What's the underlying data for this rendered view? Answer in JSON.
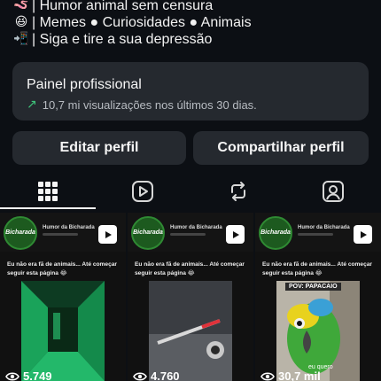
{
  "bio": {
    "lines": [
      {
        "icon": "🪱",
        "text": "| Humor animal sem censura"
      },
      {
        "icon": "😆",
        "text": "| Memes ● Curiosidades ● Animais"
      },
      {
        "icon": "📲",
        "text": "| Siga e tire a sua depressão"
      }
    ]
  },
  "professional_panel": {
    "title": "Painel profissional",
    "subtitle": "10,7 mi visualizações nos últimos 30 dias."
  },
  "buttons": {
    "edit": "Editar perfil",
    "share": "Compartilhar perfil"
  },
  "tabs": [
    {
      "icon": "grid-icon",
      "active": true
    },
    {
      "icon": "reels-icon",
      "active": false
    },
    {
      "icon": "reposts-icon",
      "active": false
    },
    {
      "icon": "tagged-icon",
      "active": false
    }
  ],
  "posts": [
    {
      "account": "Humor da Bicharada",
      "avatar_text": "Bicharada",
      "caption": "Eu não era fã de animais... Até começar seguir esta página 😂",
      "views": "5.749",
      "overlay": ""
    },
    {
      "account": "Humor da Bicharada",
      "avatar_text": "Bicharada",
      "caption": "Eu não era fã de animais... Até começar seguir esta página 😂",
      "views": "4.760",
      "overlay": ""
    },
    {
      "account": "Humor da Bicharada",
      "avatar_text": "Bicharada",
      "caption": "Eu não era fã de animais... Até começar seguir esta página 😂",
      "views": "30,7 mil",
      "overlay": "POV: PAPACAIO",
      "bottom_text": "eu quero"
    }
  ],
  "colors": {
    "background": "#0c0f14",
    "card": "#25292f",
    "accent_green": "#3ec37a"
  }
}
